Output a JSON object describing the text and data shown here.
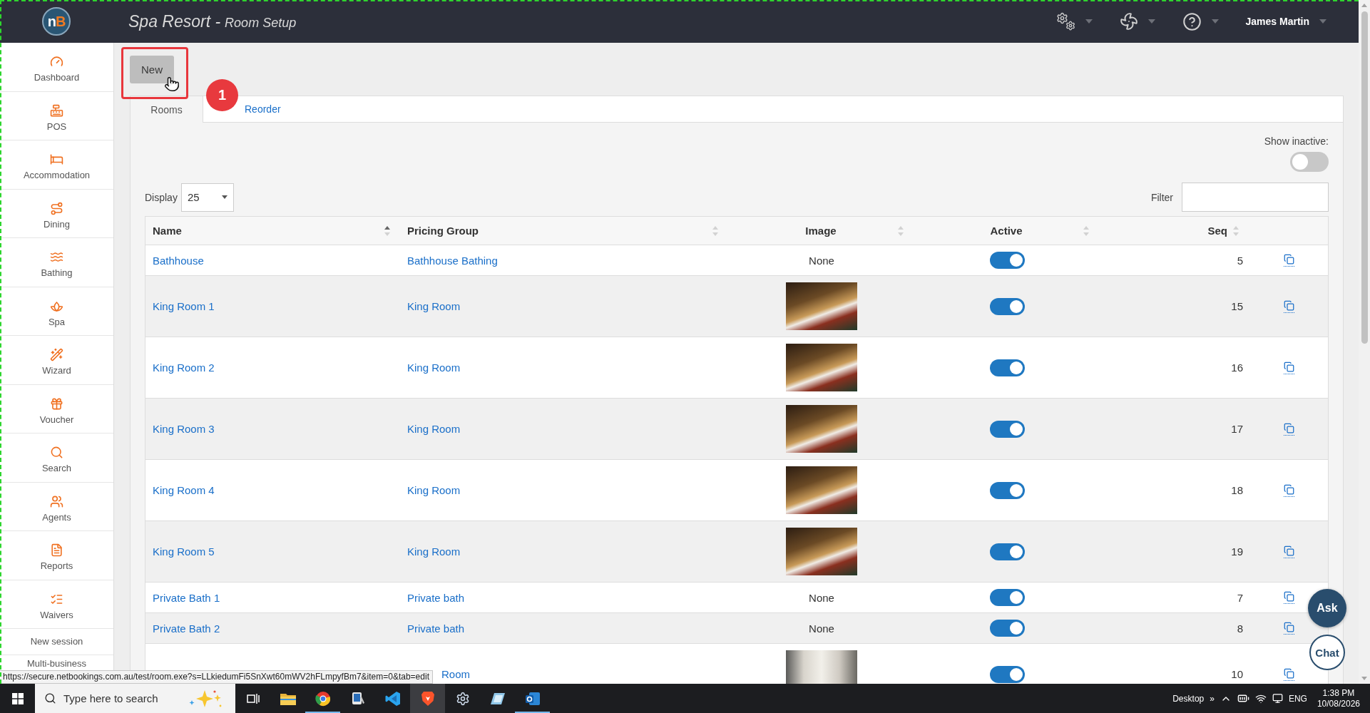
{
  "header": {
    "logo": "nB",
    "title": "Spa Resort -",
    "subtitle": "Room Setup",
    "menus": [
      {
        "kind": "gears"
      },
      {
        "kind": "fan"
      },
      {
        "kind": "help"
      },
      {
        "kind": "user",
        "label": "James Martin"
      }
    ]
  },
  "sidebar": {
    "items": [
      {
        "kind": "dashboard",
        "label": "Dashboard"
      },
      {
        "kind": "pos",
        "label": "POS"
      },
      {
        "kind": "accommodation",
        "label": "Accommodation"
      },
      {
        "kind": "dining",
        "label": "Dining"
      },
      {
        "kind": "bathing",
        "label": "Bathing"
      },
      {
        "kind": "spa",
        "label": "Spa"
      },
      {
        "kind": "wizard",
        "label": "Wizard"
      },
      {
        "kind": "voucher",
        "label": "Voucher"
      },
      {
        "kind": "search",
        "label": "Search"
      },
      {
        "kind": "agents",
        "label": "Agents"
      },
      {
        "kind": "reports",
        "label": "Reports"
      },
      {
        "kind": "waivers",
        "label": "Waivers"
      }
    ],
    "links": [
      "New session",
      "Multi-business"
    ]
  },
  "new_button": "New",
  "annotation": {
    "step": "1"
  },
  "tabs": [
    {
      "label": "Rooms",
      "selected": true
    },
    {
      "label": "Reorder",
      "selected": false
    }
  ],
  "show_inactive": {
    "label": "Show inactive:",
    "on": false
  },
  "display": {
    "label": "Display",
    "value": "25"
  },
  "filter": {
    "label": "Filter"
  },
  "table": {
    "columns": [
      {
        "label": "Name",
        "sorted": true
      },
      {
        "label": "Pricing Group",
        "sorted": false
      },
      {
        "label": "Image",
        "sorted": false
      },
      {
        "label": "Active",
        "sorted": false
      },
      {
        "label": "Seq",
        "sorted": false
      }
    ],
    "rows": [
      {
        "name": "Bathhouse",
        "pricing_group": "Bathhouse Bathing",
        "image": {
          "kind": "text",
          "text": "None"
        },
        "active": true,
        "seq": "5"
      },
      {
        "name": "King Room 1",
        "pricing_group": "King Room",
        "image": {
          "kind": "photo",
          "bright": false
        },
        "active": true,
        "seq": "15"
      },
      {
        "name": "King Room 2",
        "pricing_group": "King Room",
        "image": {
          "kind": "photo",
          "bright": false
        },
        "active": true,
        "seq": "16"
      },
      {
        "name": "King Room 3",
        "pricing_group": "King Room",
        "image": {
          "kind": "photo",
          "bright": false
        },
        "active": true,
        "seq": "17"
      },
      {
        "name": "King Room 4",
        "pricing_group": "King Room",
        "image": {
          "kind": "photo",
          "bright": false
        },
        "active": true,
        "seq": "18"
      },
      {
        "name": "King Room 5",
        "pricing_group": "King Room",
        "image": {
          "kind": "photo",
          "bright": false
        },
        "active": true,
        "seq": "19"
      },
      {
        "name": "Private Bath 1",
        "pricing_group": "Private bath",
        "image": {
          "kind": "text",
          "text": "None"
        },
        "active": true,
        "seq": "7"
      },
      {
        "name": "Private Bath 2",
        "pricing_group": "Private bath",
        "image": {
          "kind": "text",
          "text": "None"
        },
        "active": true,
        "seq": "8"
      },
      {
        "pricing_group": "Room",
        "image": {
          "kind": "photo",
          "bright": true
        },
        "active": true,
        "seq": "10"
      }
    ]
  },
  "assistant": {
    "ask": "Ask",
    "chat": "Chat"
  },
  "status_url": "https://secure.netbookings.com.au/test/room.exe?s=LLkiedumFi5SnXwt60mWV2hFLmpyfBm7&item=0&tab=edit",
  "taskbar": {
    "search": {
      "placeholder": "Type here to search"
    },
    "apps": [
      {
        "kind": "task-view",
        "selected": false,
        "running": false
      },
      {
        "kind": "folder",
        "selected": false,
        "running": false
      },
      {
        "kind": "ring",
        "selected": false,
        "running": true
      },
      {
        "kind": "device",
        "selected": false,
        "running": false
      },
      {
        "kind": "code",
        "selected": false,
        "running": false
      },
      {
        "kind": "shield",
        "selected": true,
        "running": false
      },
      {
        "kind": "gear",
        "selected": false,
        "running": false
      },
      {
        "kind": "tile",
        "selected": false,
        "running": false
      },
      {
        "kind": "mail",
        "selected": false,
        "running": true
      }
    ],
    "tray": {
      "desktop": "Desktop",
      "overflow": "»",
      "language": "ENG",
      "time": "1:38 PM",
      "date": "10/08/2026"
    }
  }
}
